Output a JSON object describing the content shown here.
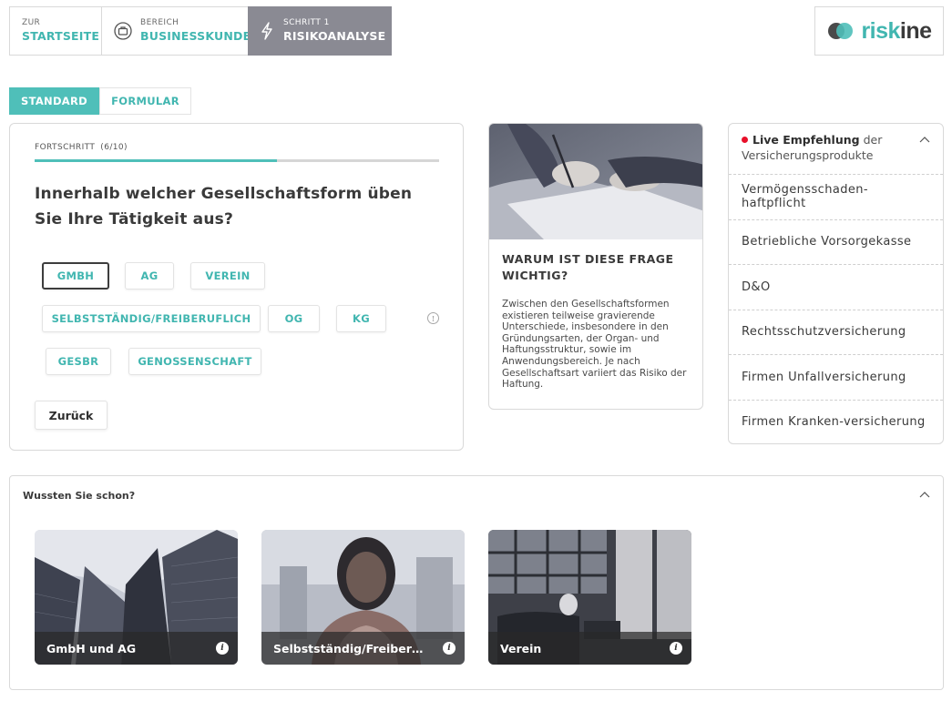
{
  "nav": {
    "home": {
      "small": "ZUR",
      "big": "STARTSEITE"
    },
    "area": {
      "small": "BEREICH",
      "big": "BUSINESSKUNDE"
    },
    "step": {
      "small": "SCHRITT 1",
      "big": "RISIKOANALYSE"
    }
  },
  "logo": {
    "text_accent": "risk",
    "text_dark": "ine"
  },
  "mode": {
    "standard": "STANDARD",
    "form": "FORMULAR",
    "active": "standard"
  },
  "question": {
    "progress_label": "FORTSCHRITT",
    "progress_count": "(6/10)",
    "progress_fraction": 0.6,
    "text": "Innerhalb welcher Gesellschaftsform üben Sie Ihre Tätigkeit aus?",
    "options": [
      "GMBH",
      "AG",
      "VEREIN",
      "SELBSTSTÄNDIG/FREIBERUFLICH",
      "OG",
      "KG",
      "GESBR",
      "GENOSSENSCHAFT"
    ],
    "selected": "GMBH",
    "back": "Zurück"
  },
  "why": {
    "title": "WARUM IST DIESE FRAGE WICHTIG?",
    "body": "Zwischen den Gesellschaftsformen existieren teilweise gravierende Unterschiede, insbesondere in den Gründungsarten, der Organ- und Haftungsstruktur, sowie im Anwendungsbereich. Je nach Gesellschaftsart variiert das Risiko der Haftung."
  },
  "recommendations": {
    "live": "Live Empfehlung",
    "suffix": "der Versicherungsprodukte",
    "items": [
      "Vermögensschaden-haftpflicht",
      "Betriebliche Vorsorgekasse",
      "D&O",
      "Rechtsschutzversicherung",
      "Firmen Unfallversicherung",
      "Firmen Kranken-versicherung"
    ]
  },
  "did_you_know": {
    "title": "Wussten Sie schon?",
    "tiles": [
      {
        "label": "GmbH und AG"
      },
      {
        "label": "Selbstständig/Freiberuflich"
      },
      {
        "label": "Verein"
      }
    ]
  },
  "colors": {
    "accent": "#4fbfb9",
    "step_bg": "#8a8a93",
    "live_dot": "#e8102a"
  }
}
